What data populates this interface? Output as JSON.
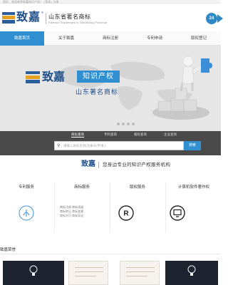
{
  "top_strip": {
    "text": "您好，欢迎来到致嘉知识产权！ | 登录 | 注册"
  },
  "header": {
    "logo_text": "致嘉",
    "logo_reg": "®",
    "brand_cn": "山东省著名商标",
    "brand_en": "Famous Trademark in Shandong Province",
    "phone_icon": "24"
  },
  "nav": {
    "items": [
      {
        "label": "致嘉首页",
        "active": true
      },
      {
        "label": "关于致嘉",
        "active": false
      },
      {
        "label": "商标注册",
        "active": false
      },
      {
        "label": "专利申请",
        "active": false
      },
      {
        "label": "版权登记",
        "active": false
      }
    ]
  },
  "banner": {
    "logo_text": "致嘉",
    "tag": "知识产权",
    "sub": "山东著名商标"
  },
  "search": {
    "tabs": [
      {
        "label": "商标查询",
        "active": true
      },
      {
        "label": "专利查询",
        "active": false
      },
      {
        "label": "版权查询",
        "active": false
      },
      {
        "label": "企业查询",
        "active": false
      }
    ],
    "placeholder": "请输入商标名称/注册号/申请人",
    "button": "搜索"
  },
  "tagline": {
    "logo": "致嘉",
    "text": "您身边专业的知识产权服务机构"
  },
  "services": [
    {
      "title": "专利服务",
      "text": ""
    },
    {
      "title": "商标服务",
      "text": "商标注册 商标续展\n商标转让 商标变更\n商标许可 商标异议"
    },
    {
      "title": "版权服务",
      "text": ""
    },
    {
      "title": "计算机软件著作权",
      "text": ""
    }
  ],
  "section": {
    "title": "致嘉荣誉"
  }
}
